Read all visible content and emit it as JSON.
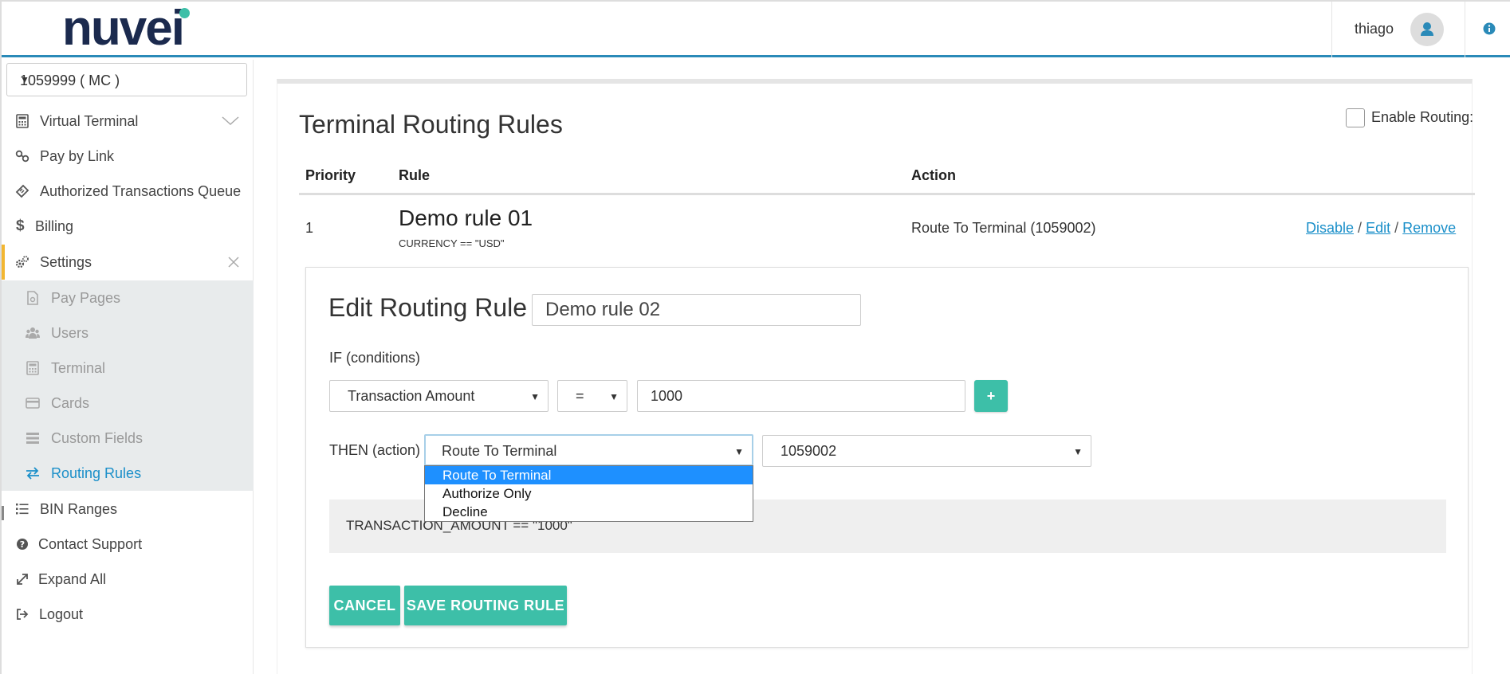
{
  "header": {
    "logo_text": "nuvei",
    "user_name": "thiago"
  },
  "sidebar": {
    "merchant_select": "1059999 ( MC )",
    "items": [
      {
        "label": "Virtual Terminal"
      },
      {
        "label": "Pay by Link"
      },
      {
        "label": "Authorized Transactions Queue"
      },
      {
        "label": "Billing"
      },
      {
        "label": "Settings"
      },
      {
        "label": "BIN Ranges"
      },
      {
        "label": "Contact Support"
      },
      {
        "label": "Expand All"
      },
      {
        "label": "Logout"
      }
    ],
    "settings_sub": [
      {
        "label": "Pay Pages"
      },
      {
        "label": "Users"
      },
      {
        "label": "Terminal"
      },
      {
        "label": "Cards"
      },
      {
        "label": "Custom Fields"
      },
      {
        "label": "Routing Rules"
      }
    ]
  },
  "page": {
    "title": "Terminal Routing Rules",
    "enable_routing_label": "Enable Routing:",
    "table": {
      "headers": [
        "Priority",
        "Rule",
        "Action"
      ],
      "rows": [
        {
          "priority": "1",
          "rule_name": "Demo rule 01",
          "rule_condition": "CURRENCY == \"USD\"",
          "action": "Route To Terminal (1059002)",
          "links": [
            "Disable",
            "Edit",
            "Remove"
          ]
        }
      ]
    }
  },
  "edit": {
    "title": "Edit Routing Rule",
    "rule_name_value": "Demo rule 02",
    "if_label": "IF (conditions)",
    "condition_field": "Transaction Amount",
    "condition_operator": "=",
    "condition_value": "1000",
    "add_button": "+",
    "then_label": "THEN (action)",
    "action_select": "Route To Terminal",
    "terminal_select": "1059002",
    "action_options": [
      "Route To Terminal",
      "Authorize Only",
      "Decline"
    ],
    "expression": "TRANSACTION_AMOUNT == \"1000\"",
    "cancel_button": "CANCEL",
    "save_button": "SAVE ROUTING RULE"
  },
  "colors": {
    "accent": "#3dbfa8",
    "link": "#1a8fc9",
    "header_rule": "#2a8ab8",
    "active_marker": "#f2b631",
    "logo": "#1b2a4e"
  }
}
